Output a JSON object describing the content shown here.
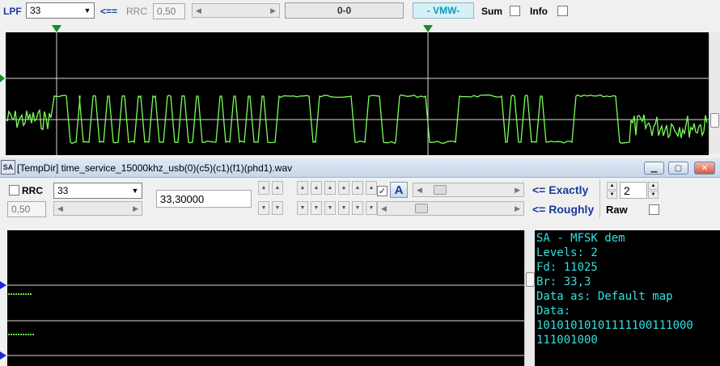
{
  "toolbar": {
    "lpf_label": "LPF",
    "lpf_value": "33",
    "arrow_label": "<==",
    "rrc_label": "RRC",
    "rrc_value": "0,50",
    "center_readout": "0-0",
    "mode": "- VMW-",
    "sum_label": "Sum",
    "info_label": "Info"
  },
  "window": {
    "title": "[TempDir] time_service_15000khz_usb(0)(c5)(c1)(f1)(phd1).wav",
    "icon_text": "SA"
  },
  "controls": {
    "rrc_label": "RRC",
    "rrc_value": "0,50",
    "combo_value": "33",
    "baud_value": "33,30000",
    "exactly_label": "<= Exactly",
    "roughly_label": "<= Roughly",
    "levels_value": "2",
    "raw_label": "Raw",
    "a_label": "A"
  },
  "output": {
    "lines": [
      "SA - MFSK dem",
      "Levels: 2",
      "Fd: 11025",
      "Br: 33,3",
      "Data as: Default map",
      "Data:",
      "10101010101111100111000",
      "111001000"
    ]
  },
  "colors": {
    "trace": "#7cff5a",
    "output_text": "#33e0e0",
    "marker_green": "#1a8a2a",
    "marker_blue": "#1a2ad8"
  },
  "icons": [
    "dropdown-arrow-icon",
    "marker-triangle-icon",
    "minimize-icon",
    "maximize-icon",
    "close-icon",
    "font-a-icon",
    "spin-up-icon",
    "spin-down-icon"
  ]
}
